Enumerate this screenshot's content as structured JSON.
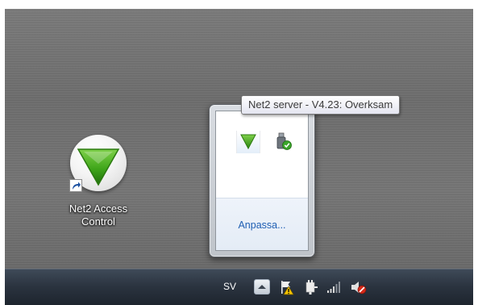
{
  "desktop": {
    "shortcut": {
      "label_line1": "Net2 Access",
      "label_line2": "Control",
      "icon": "net2-green-triangle-icon"
    }
  },
  "tray_popup": {
    "icons": [
      {
        "name": "net2-server-tray-icon",
        "selected": true
      },
      {
        "name": "usb-safely-remove-tray-icon",
        "selected": false
      }
    ],
    "customize_link": "Anpassa..."
  },
  "tooltip": {
    "text": "Net2 server - V4.23: Overksam"
  },
  "taskbar": {
    "language": "SV",
    "show_hidden_icons": "chevron-up-icon",
    "tray_icons": [
      "action-center-flag-warning-icon",
      "power-plug-icon",
      "network-signal-icon",
      "volume-muted-icon"
    ]
  },
  "colors": {
    "accent_green": "#3fa51a",
    "link_blue": "#1f5fb3",
    "taskbar": "#2b3440"
  }
}
